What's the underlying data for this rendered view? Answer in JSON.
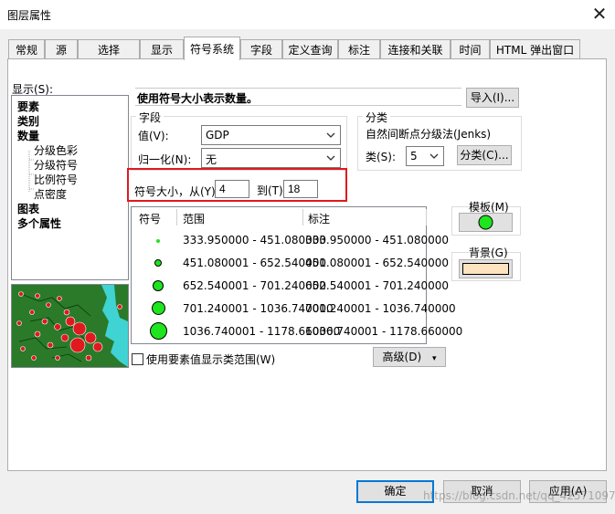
{
  "window": {
    "title": "图层属性",
    "close_glyph": "✕"
  },
  "tabs": [
    {
      "label": "常规"
    },
    {
      "label": "源"
    },
    {
      "label": "选择"
    },
    {
      "label": "显示"
    },
    {
      "label": "符号系统"
    },
    {
      "label": "字段"
    },
    {
      "label": "定义查询"
    },
    {
      "label": "标注"
    },
    {
      "label": "连接和关联"
    },
    {
      "label": "时间"
    },
    {
      "label": "HTML 弹出窗口"
    }
  ],
  "active_tab": "符号系统",
  "show_panel": {
    "label": "显示(S):",
    "items": [
      {
        "label": "要素",
        "bold": true
      },
      {
        "label": "类别",
        "bold": true
      },
      {
        "label": "数量",
        "bold": true
      },
      {
        "label": "分级色彩",
        "bold": false
      },
      {
        "label": "分级符号",
        "bold": false
      },
      {
        "label": "比例符号",
        "bold": false
      },
      {
        "label": "点密度",
        "bold": false
      },
      {
        "label": "图表",
        "bold": true
      },
      {
        "label": "多个属性",
        "bold": true
      }
    ]
  },
  "heading": "使用符号大小表示数量。",
  "import_button": "导入(I)...",
  "fields": {
    "group_label": "字段",
    "value_label": "值(V):",
    "value_selected": "GDP",
    "normalize_label": "归一化(N):",
    "normalize_selected": "无"
  },
  "classification": {
    "group_label": "分类",
    "method": "自然间断点分级法(Jenks)",
    "classes_label": "类(S):",
    "classes_value": "5",
    "classify_button": "分类(C)..."
  },
  "symbol_size": {
    "from_label": "符号大小，从(Y)",
    "from_value": "4",
    "to_label": "到(T):",
    "to_value": "18"
  },
  "template": {
    "label": "模板(M)",
    "color": "#1ee51e"
  },
  "background": {
    "label": "背景(G)",
    "color": "#fde3bf"
  },
  "table": {
    "headers": [
      "符号",
      "范围",
      "标注"
    ],
    "rows": [
      {
        "range": "333.950000 - 451.080000",
        "label": "333.950000 - 451.080000"
      },
      {
        "range": "451.080001 - 652.540000",
        "label": "451.080001 - 652.540000"
      },
      {
        "range": "652.540001 - 701.240000",
        "label": "652.540001 - 701.240000"
      },
      {
        "range": "701.240001 - 1036.740000",
        "label": "701.240001 - 1036.740000"
      },
      {
        "range": "1036.740001 - 1178.660000",
        "label": "1036.740001 - 1178.660000"
      }
    ]
  },
  "show_range_checkbox": {
    "label": "使用要素值显示类范围(W)",
    "checked": false
  },
  "advanced_button": "高级(D)",
  "footer": {
    "ok": "确定",
    "cancel": "取消",
    "apply": "应用(A)"
  },
  "watermark": "https://blog.csdn.net/qq_42571097",
  "colors": {
    "symbol_fill": "#1ee51e",
    "highlight_border": "#e0191e",
    "map_water": "#3fd3d3",
    "map_land": "#2a7a2a"
  }
}
